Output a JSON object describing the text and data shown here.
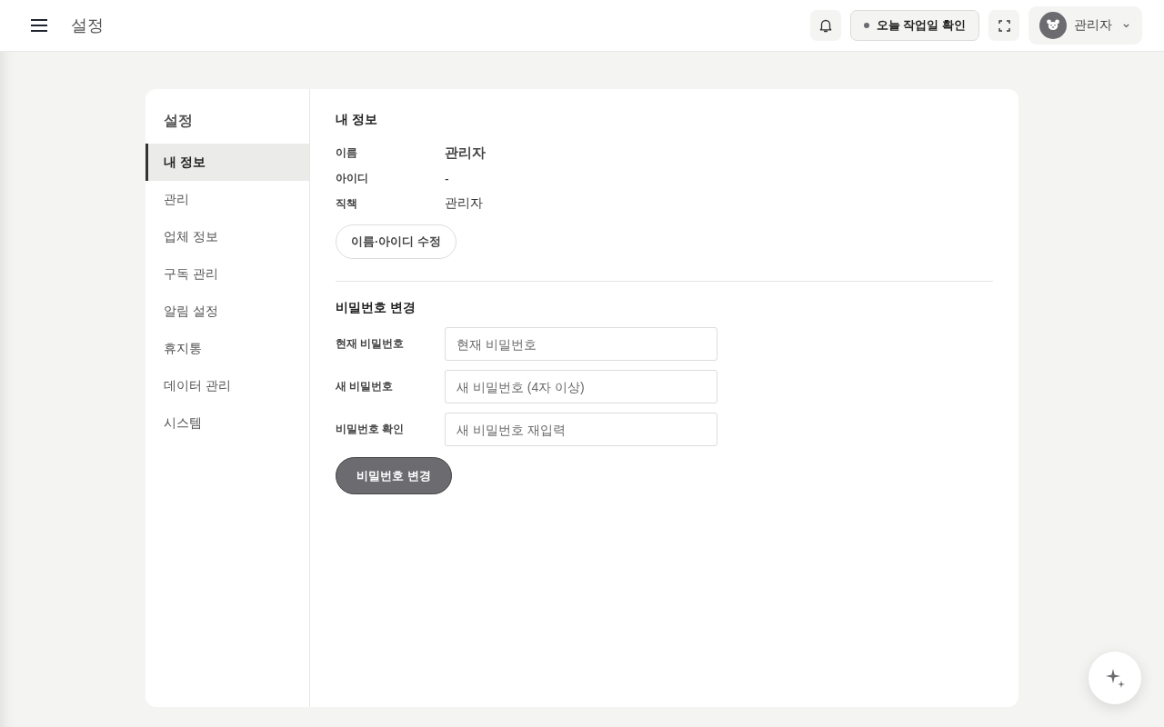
{
  "header": {
    "title": "설정",
    "workday_button": "오늘 작업일 확인",
    "user": {
      "name": "관리자"
    }
  },
  "sidebar": {
    "title": "설정",
    "items": [
      {
        "label": "내 정보",
        "selected": true
      },
      {
        "label": "관리",
        "selected": false
      },
      {
        "label": "업체 정보",
        "selected": false
      },
      {
        "label": "구독 관리",
        "selected": false
      },
      {
        "label": "알림 설정",
        "selected": false
      },
      {
        "label": "휴지통",
        "selected": false
      },
      {
        "label": "데이터 관리",
        "selected": false
      },
      {
        "label": "시스템",
        "selected": false
      }
    ]
  },
  "profile": {
    "title": "내 정보",
    "fields": [
      {
        "label": "이름",
        "value": "관리자",
        "kind": "emphasis"
      },
      {
        "label": "아이디",
        "value": "-",
        "kind": "plain"
      },
      {
        "label": "직책",
        "value": "관리자",
        "kind": "plain"
      }
    ],
    "edit_button": "이름·아이디 수정"
  },
  "password": {
    "title": "비밀번호 변경",
    "fields": [
      {
        "label": "현재 비밀번호",
        "placeholder": "현재 비밀번호"
      },
      {
        "label": "새 비밀번호",
        "placeholder": "새 비밀번호 (4자 이상)"
      },
      {
        "label": "비밀번호 확인",
        "placeholder": "새 비밀번호 재입력"
      }
    ],
    "submit_button": "비밀번호 변경"
  }
}
